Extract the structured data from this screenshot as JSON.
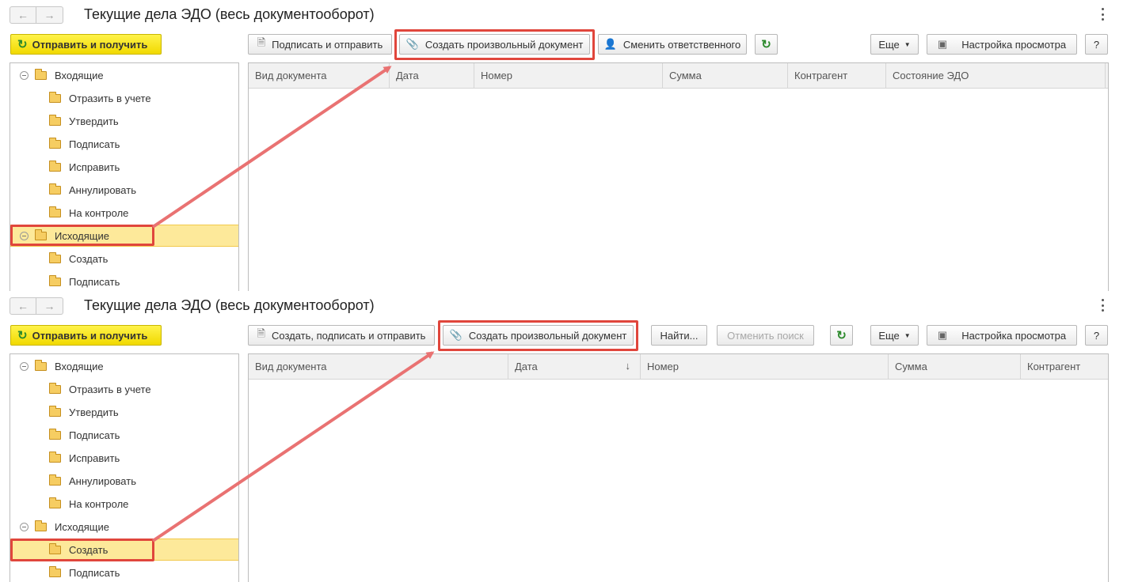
{
  "colors": {
    "highlight_red": "#e0463c",
    "arrow": "#e97272",
    "primary_yellow": "#f6e21a",
    "selected_row": "#fde99a",
    "refresh_green": "#2d8a2d"
  },
  "panel1": {
    "title": "Текущие дела ЭДО (весь документооборот)",
    "send_receive": "Отправить и получить",
    "toolbar": {
      "sign_send": "Подписать и отправить",
      "create_arbitrary": "Создать произвольный документ",
      "change_responsible": "Сменить ответственного",
      "more": "Еще",
      "view_settings": "Настройка просмотра",
      "help": "?"
    },
    "tree": [
      {
        "label": "Входящие",
        "level": 0
      },
      {
        "label": "Отразить в учете",
        "level": 1
      },
      {
        "label": "Утвердить",
        "level": 1
      },
      {
        "label": "Подписать",
        "level": 1
      },
      {
        "label": "Исправить",
        "level": 1
      },
      {
        "label": "Аннулировать",
        "level": 1
      },
      {
        "label": "На контроле",
        "level": 1
      },
      {
        "label": "Исходящие",
        "level": 0,
        "selected": true
      },
      {
        "label": "Создать",
        "level": 1
      },
      {
        "label": "Подписать",
        "level": 1
      }
    ],
    "columns": [
      "Вид документа",
      "Дата",
      "Номер",
      "Сумма",
      "Контрагент",
      "Состояние ЭДО"
    ]
  },
  "panel2": {
    "title": "Текущие дела ЭДО (весь документооборот)",
    "send_receive": "Отправить и получить",
    "toolbar": {
      "create_sign_send": "Создать, подписать и отправить",
      "create_arbitrary": "Создать произвольный документ",
      "find": "Найти...",
      "cancel_search": "Отменить поиск",
      "more": "Еще",
      "view_settings": "Настройка просмотра",
      "help": "?"
    },
    "tree": [
      {
        "label": "Входящие",
        "level": 0
      },
      {
        "label": "Отразить в учете",
        "level": 1
      },
      {
        "label": "Утвердить",
        "level": 1
      },
      {
        "label": "Подписать",
        "level": 1
      },
      {
        "label": "Исправить",
        "level": 1
      },
      {
        "label": "Аннулировать",
        "level": 1
      },
      {
        "label": "На контроле",
        "level": 1
      },
      {
        "label": "Исходящие",
        "level": 0
      },
      {
        "label": "Создать",
        "level": 1,
        "selected": true
      },
      {
        "label": "Подписать",
        "level": 1
      }
    ],
    "columns": [
      "Вид документа",
      "Дата",
      "Номер",
      "Сумма",
      "Контрагент"
    ],
    "sort_indicator": "↓"
  }
}
